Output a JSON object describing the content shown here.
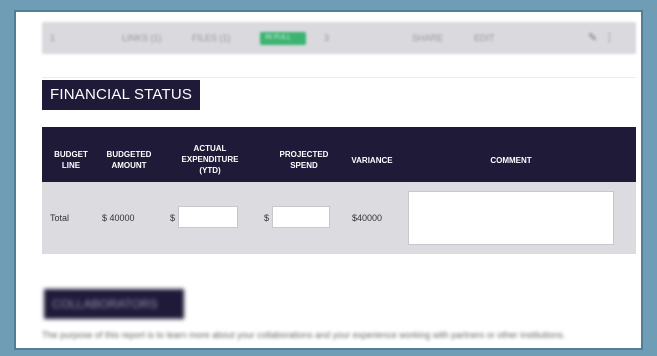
{
  "topbar": {
    "items": [
      "1",
      "LINKS (1)",
      "FILES (1)",
      "IN FULL",
      "3",
      "SHARE",
      "EDIT"
    ],
    "tools": [
      "✎",
      "⋮"
    ]
  },
  "financial_section": {
    "title": "FINANCIAL STATUS",
    "columns": {
      "budget_line": [
        "BUDGET",
        "LINE"
      ],
      "budgeted_amount": [
        "BUDGETED",
        "AMOUNT"
      ],
      "actual_expenditure": [
        "ACTUAL",
        "EXPENDITURE",
        "(YTD)"
      ],
      "projected_spend": [
        "PROJECTED",
        "SPEND"
      ],
      "variance": "VARIANCE",
      "comment": "COMMENT"
    },
    "row": {
      "budget_line": "Total",
      "budgeted_amount": "$ 40000",
      "currency_symbol": "$",
      "actual_expenditure_value": "",
      "projected_spend_value": "",
      "variance": "$40000",
      "comment_value": ""
    }
  },
  "collaborators_section": {
    "title": "COLLABORATORS",
    "intro": "The purpose of this report is to learn more about your collaborations and your experience working with partners or other institutions."
  }
}
